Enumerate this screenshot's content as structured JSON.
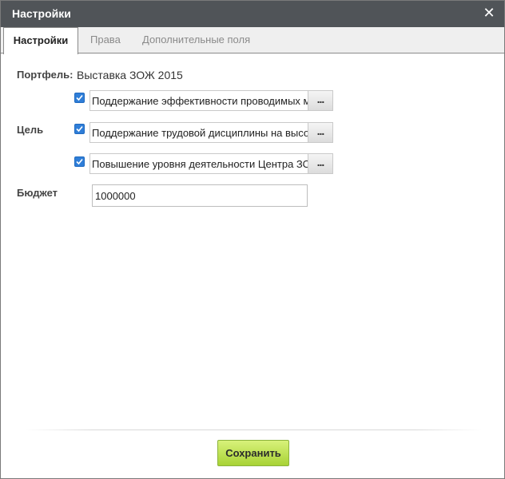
{
  "window": {
    "title": "Настройки",
    "close_glyph": "✕"
  },
  "tabs": [
    {
      "label": "Настройки",
      "active": true
    },
    {
      "label": "Права",
      "active": false
    },
    {
      "label": "Дополнительные поля",
      "active": false
    }
  ],
  "form": {
    "portfolio_label": "Портфель:",
    "portfolio_value": "Выставка ЗОЖ 2015",
    "goal_label": "Цель",
    "goals": [
      {
        "checked": true,
        "text": "Поддержание эффективности проводимых меро",
        "button": "..."
      },
      {
        "checked": true,
        "text": "Поддержание трудовой дисциплины на высоком",
        "button": "..."
      },
      {
        "checked": true,
        "text": "Повышение уровня деятельности Центра ЗОЖ",
        "button": "..."
      }
    ],
    "budget_label": "Бюджет",
    "budget_value": "1000000"
  },
  "footer": {
    "save_label": "Сохранить"
  },
  "colors": {
    "titlebar": "#505458",
    "checkbox": "#2f7ed8",
    "save_button": "#a8d335"
  }
}
